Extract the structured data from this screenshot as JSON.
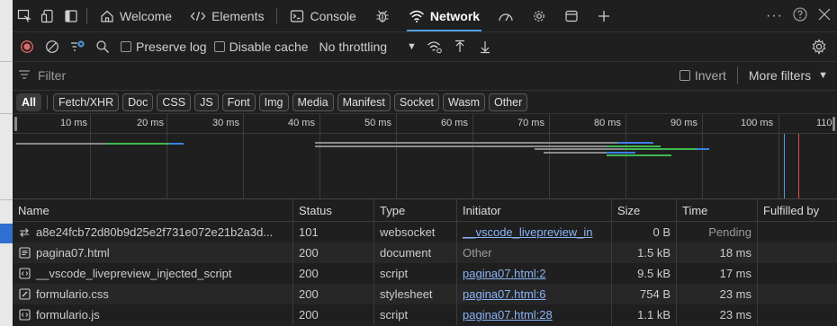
{
  "tabs": [
    {
      "label": "Welcome",
      "icon": "home-icon"
    },
    {
      "label": "Elements",
      "icon": "code-brackets-icon"
    },
    {
      "label": "Console",
      "icon": "console-icon"
    },
    {
      "label": "Network",
      "icon": "wifi-icon",
      "active": true
    }
  ],
  "toolbar": {
    "preserve_log": "Preserve log",
    "disable_cache": "Disable cache",
    "throttling": "No throttling"
  },
  "filter": {
    "placeholder": "Filter",
    "invert": "Invert",
    "more_filters": "More filters"
  },
  "type_filters": [
    "All",
    "Fetch/XHR",
    "Doc",
    "CSS",
    "JS",
    "Font",
    "Img",
    "Media",
    "Manifest",
    "Socket",
    "Wasm",
    "Other"
  ],
  "timeline": {
    "ticks": [
      "10 ms",
      "20 ms",
      "30 ms",
      "40 ms",
      "50 ms",
      "60 ms",
      "70 ms",
      "80 ms",
      "90 ms",
      "100 ms",
      "110"
    ]
  },
  "table": {
    "headers": {
      "name": "Name",
      "status": "Status",
      "type": "Type",
      "initiator": "Initiator",
      "size": "Size",
      "time": "Time",
      "fulfilled": "Fulfilled by"
    },
    "rows": [
      {
        "name": "a8e24fcb72d80b9d25e2f731e072e21b2a3d...",
        "icon": "websocket-icon",
        "status": "101",
        "type": "websocket",
        "initiator": "__vscode_livepreview_in",
        "initiator_link": true,
        "size": "0 B",
        "time": "Pending",
        "time_muted": true,
        "fulfilled": ""
      },
      {
        "name": "pagina07.html",
        "icon": "document-icon",
        "status": "200",
        "type": "document",
        "initiator": "Other",
        "initiator_link": false,
        "size": "1.5 kB",
        "time": "18 ms",
        "time_muted": false,
        "fulfilled": ""
      },
      {
        "name": "__vscode_livepreview_injected_script",
        "icon": "script-icon",
        "status": "200",
        "type": "script",
        "initiator": "pagina07.html:2",
        "initiator_link": true,
        "size": "9.5 kB",
        "time": "17 ms",
        "time_muted": false,
        "fulfilled": ""
      },
      {
        "name": "formulario.css",
        "icon": "stylesheet-icon",
        "status": "200",
        "type": "stylesheet",
        "initiator": "pagina07.html:6",
        "initiator_link": true,
        "size": "754 B",
        "time": "23 ms",
        "time_muted": false,
        "fulfilled": ""
      },
      {
        "name": "formulario.js",
        "icon": "script-icon",
        "status": "200",
        "type": "script",
        "initiator": "pagina07.html:28",
        "initiator_link": true,
        "size": "1.1 kB",
        "time": "23 ms",
        "time_muted": false,
        "fulfilled": ""
      }
    ]
  },
  "colors": {
    "record": "#e46962",
    "accent": "#4d9de0",
    "link": "#8ab4f8",
    "bar_gray": "#8a8a8a",
    "bar_green": "#3fb950",
    "bar_blue": "#3d7fe6"
  }
}
